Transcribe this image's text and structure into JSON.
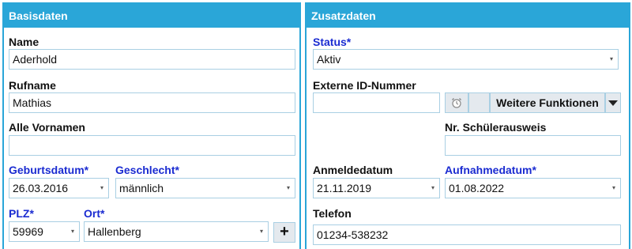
{
  "left_panel": {
    "title": "Basisdaten",
    "name_label": "Name",
    "name_value": "Aderhold",
    "rufname_label": "Rufname",
    "rufname_value": "Mathias",
    "vornamen_label": "Alle Vornamen",
    "vornamen_value": "",
    "geburtsdatum_label": "Geburtsdatum*",
    "geburtsdatum_value": "26.03.2016",
    "geschlecht_label": "Geschlecht*",
    "geschlecht_value": "männlich",
    "plz_label": "PLZ*",
    "plz_value": "59969",
    "ort_label": "Ort*",
    "ort_value": "Hallenberg",
    "add_button_label": "+"
  },
  "right_panel": {
    "title": "Zusatzdaten",
    "status_label": "Status*",
    "status_value": "Aktiv",
    "externe_id_label": "Externe ID-Nummer",
    "externe_id_value": "",
    "weitere_label": "Weitere Funktionen",
    "schuelerausweis_label": "Nr. Schülerausweis",
    "schuelerausweis_value": "",
    "anmeldedatum_label": "Anmeldedatum",
    "anmeldedatum_value": "21.11.2019",
    "aufnahmedatum_label": "Aufnahmedatum*",
    "aufnahmedatum_value": "01.08.2022",
    "telefon_label": "Telefon",
    "telefon_value": "01234-538232"
  },
  "icons": {
    "dropdown_caret": "▾",
    "alarm": "alarm-clock-icon"
  },
  "colors": {
    "header_bg": "#2aa6d8",
    "required_label": "#1a2bd1",
    "field_border": "#a9cfe3"
  }
}
